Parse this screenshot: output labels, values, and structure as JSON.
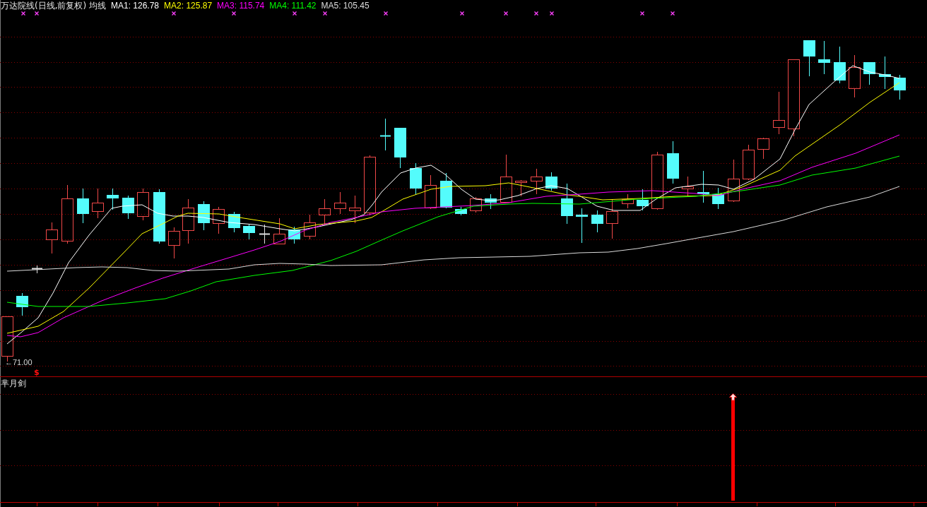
{
  "price_panel": {
    "title": "万达院线(日线,前复权) 均线",
    "legend": [
      {
        "label": "MA1: 126.78",
        "color": "#ffffff"
      },
      {
        "label": "MA2: 125.87",
        "color": "#ffff00"
      },
      {
        "label": "MA3: 115.74",
        "color": "#ff00ff"
      },
      {
        "label": "MA4: 111.42",
        "color": "#00ff00"
      },
      {
        "label": "MA5: 105.45",
        "color": "#dcdcdc"
      }
    ],
    "low_price_label": "←71.00",
    "signal_symbol": "$"
  },
  "indicator_panel": {
    "title": "芈月剑"
  }
}
